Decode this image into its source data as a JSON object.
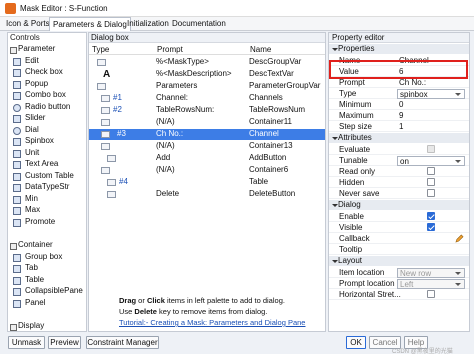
{
  "window": {
    "title": "Mask Editor : S-Function"
  },
  "tabs": [
    "Icon & Ports",
    "Parameters & Dialog",
    "Initialization",
    "Documentation"
  ],
  "controls": {
    "header": "Controls",
    "parameter_section": "Parameter",
    "parameter_items": [
      "Edit",
      "Check box",
      "Popup",
      "Combo box",
      "Radio button",
      "Slider",
      "Dial",
      "Spinbox",
      "Unit",
      "Text Area",
      "Custom Table",
      "DataTypeStr",
      "Min",
      "Max",
      "Promote"
    ],
    "container_section": "Container",
    "container_items": [
      "Group box",
      "Tab",
      "Table",
      "CollapsiblePane",
      "Panel"
    ],
    "display_section": "Display"
  },
  "dialog": {
    "header": "Dialog box",
    "columns": [
      "Type",
      "Prompt",
      "Name"
    ],
    "rows": [
      {
        "type": "",
        "prompt": "%<MaskType>",
        "name": "DescGroupVar"
      },
      {
        "type": "A",
        "prompt": "%<MaskDescription>",
        "name": "DescTextVar"
      },
      {
        "type": "",
        "prompt": "Parameters",
        "name": "ParameterGroupVar"
      },
      {
        "type": "#1",
        "prompt": "Channel:",
        "name": "Channels"
      },
      {
        "type": "#2",
        "prompt": "TableRowsNum:",
        "name": "TableRowsNum"
      },
      {
        "type": "",
        "prompt": "(N/A)",
        "name": "Container11"
      },
      {
        "type": "#3",
        "prompt": "Ch No.:",
        "name": "Channel"
      },
      {
        "type": "",
        "prompt": "(N/A)",
        "name": "Container13"
      },
      {
        "type": "",
        "prompt": "Add",
        "name": "AddButton"
      },
      {
        "type": "",
        "prompt": "(N/A)",
        "name": "Container6"
      },
      {
        "type": "#4",
        "prompt": "",
        "name": "Table"
      },
      {
        "type": "",
        "prompt": "Delete",
        "name": "DeleteButton"
      }
    ],
    "hint_line1_a": "Drag",
    "hint_line1_b": " or ",
    "hint_line1_c": "Click",
    "hint_line1_d": " items in left palette to add to dialog.",
    "hint_line2_a": "Use ",
    "hint_line2_b": "Delete",
    "hint_line2_c": " key to remove items from dialog.",
    "hint_link": "Tutorial:- Creating a Mask: Parameters and Dialog Pane"
  },
  "property_editor": {
    "header": "Property editor",
    "sections": {
      "properties": "Properties",
      "attributes": "Attributes",
      "dialog": "Dialog",
      "layout": "Layout"
    },
    "properties": [
      {
        "name": "Name",
        "value": "Channel"
      },
      {
        "name": "Value",
        "value": "6"
      },
      {
        "name": "Prompt",
        "value": "Ch No.:"
      },
      {
        "name": "Type",
        "value": "spinbox"
      },
      {
        "name": "Minimum",
        "value": "0"
      },
      {
        "name": "Maximum",
        "value": "9"
      },
      {
        "name": "Step size",
        "value": "1"
      }
    ],
    "attributes": [
      {
        "name": "Evaluate"
      },
      {
        "name": "Tunable",
        "value": "on"
      },
      {
        "name": "Read only"
      },
      {
        "name": "Hidden"
      },
      {
        "name": "Never save"
      }
    ],
    "dialog": [
      {
        "name": "Enable",
        "checked": true
      },
      {
        "name": "Visible",
        "checked": true
      },
      {
        "name": "Callback"
      },
      {
        "name": "Tooltip"
      }
    ],
    "layout": [
      {
        "name": "Item location",
        "value": "New row"
      },
      {
        "name": "Prompt location",
        "value": "Left"
      },
      {
        "name": "Horizontal Stret...",
        "checked": false
      }
    ]
  },
  "buttons": {
    "unmask": "Unmask",
    "preview": "Preview",
    "constraint": "Constraint Manager",
    "ok": "OK",
    "cancel": "Cancel",
    "help": "Help"
  },
  "watermark": "CSDN @黑夜里的光猫",
  "colors": {
    "selection": "#3d7de6",
    "highlight_box": "#e0201c",
    "checkbox_on": "#2a6ad6"
  }
}
